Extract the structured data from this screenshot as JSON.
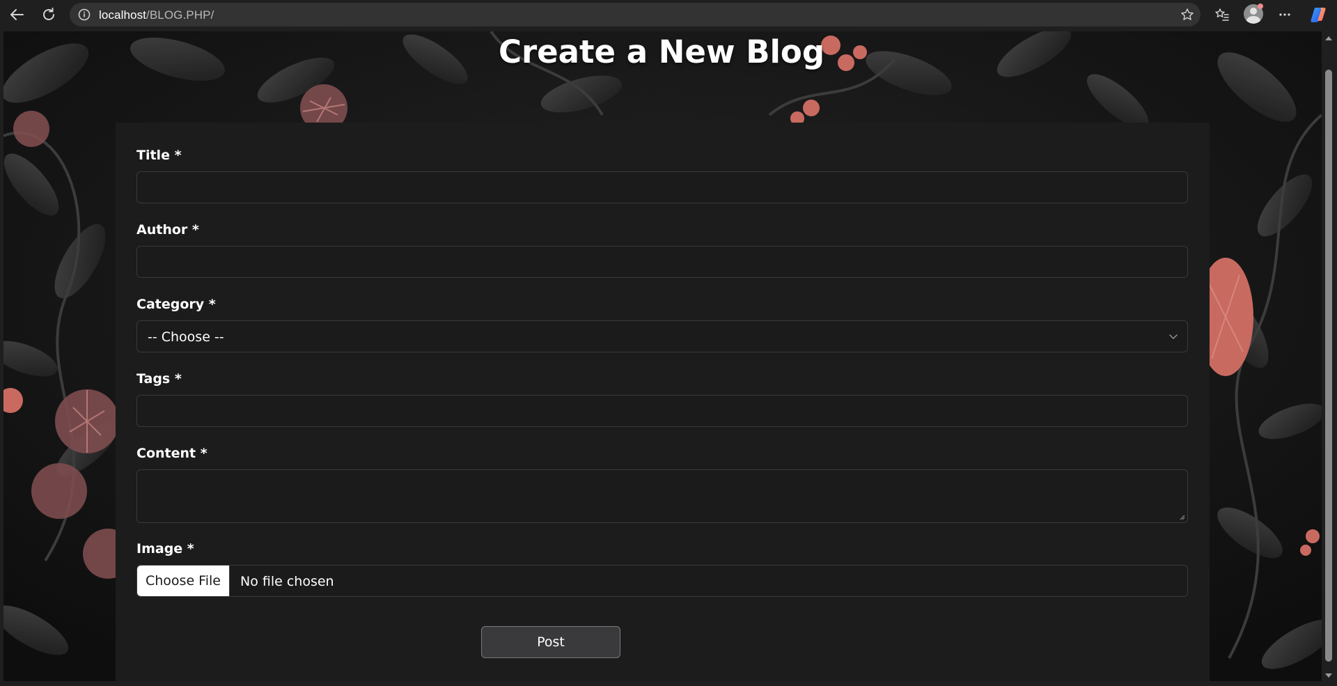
{
  "browser": {
    "url_host": "localhost",
    "url_path": "/BLOG.PHP/"
  },
  "page": {
    "heading": "Create a New Blog"
  },
  "form": {
    "title_label": "Title *",
    "author_label": "Author *",
    "category_label": "Category *",
    "category_selected": "-- Choose --",
    "tags_label": "Tags *",
    "content_label": "Content *",
    "image_label": "Image *",
    "file_button_label": "Choose File",
    "file_status": "No file chosen",
    "submit_label": "Post"
  },
  "colors": {
    "page_background": "#151515",
    "panel_background": "#1c1c1c",
    "field_border": "#3a3a3a",
    "post_button": "#3a3a3c",
    "flower_accent": "#c96a60"
  },
  "icons": {
    "back": "back-arrow-icon",
    "reload": "reload-icon",
    "info": "info-icon",
    "favorite": "star-icon",
    "favorites": "favorites-icon",
    "profile": "profile-avatar-icon",
    "more": "more-options-icon",
    "copilot": "copilot-icon",
    "select": "chevron-down-icon"
  }
}
